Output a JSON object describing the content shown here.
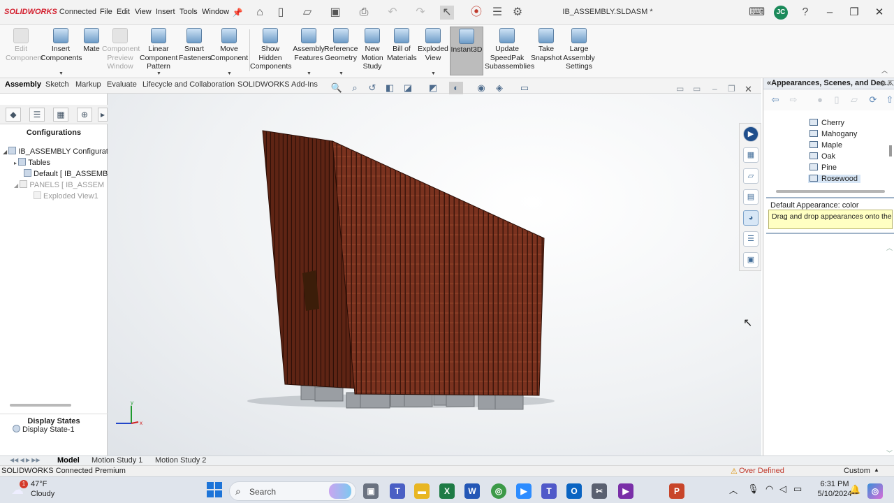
{
  "app": {
    "brand": "SOLIDWORKS",
    "edition": "Connected",
    "document_title": "IB_ASSEMBLY.SLDASM *",
    "user_initials": "JC"
  },
  "menu": [
    "File",
    "Edit",
    "View",
    "Insert",
    "Tools",
    "Window"
  ],
  "ribbon": [
    {
      "label": "Edit Component",
      "enabled": false
    },
    {
      "label": "Insert Components",
      "enabled": true
    },
    {
      "label": "Mate",
      "enabled": true
    },
    {
      "label": "Component Preview Window",
      "enabled": false
    },
    {
      "label": "Linear Component Pattern",
      "enabled": true
    },
    {
      "label": "Smart Fasteners",
      "enabled": true
    },
    {
      "label": "Move Component",
      "enabled": true
    },
    {
      "label": "Show Hidden Components",
      "enabled": true
    },
    {
      "label": "Assembly Features",
      "enabled": true
    },
    {
      "label": "Reference Geometry",
      "enabled": true
    },
    {
      "label": "New Motion Study",
      "enabled": true
    },
    {
      "label": "Bill of Materials",
      "enabled": true
    },
    {
      "label": "Exploded View",
      "enabled": true
    },
    {
      "label": "Instant3D",
      "enabled": true,
      "active": true
    },
    {
      "label": "Update SpeedPak Subassemblies",
      "enabled": true
    },
    {
      "label": "Take Snapshot",
      "enabled": true
    },
    {
      "label": "Large Assembly Settings",
      "enabled": true
    }
  ],
  "command_tabs": [
    "Assembly",
    "Sketch",
    "Markup",
    "Evaluate",
    "Lifecycle and Collaboration",
    "SOLIDWORKS Add-Ins"
  ],
  "left_panel": {
    "title": "Configurations",
    "tree": [
      {
        "label": "IB_ASSEMBLY Configuration",
        "level": 0,
        "gray": false
      },
      {
        "label": "Tables",
        "level": 1,
        "gray": false
      },
      {
        "label": "Default [ IB_ASSEMB",
        "level": 2,
        "gray": false
      },
      {
        "label": "PANELS [ IB_ASSEM",
        "level": 1,
        "gray": true
      },
      {
        "label": "Exploded View1",
        "level": 2,
        "gray": true
      }
    ],
    "display_states_title": "Display States",
    "display_state": "Display State-1"
  },
  "task_pane": {
    "title": "Appearances, Scenes, and Dec...",
    "folders": [
      "Cherry",
      "Mahogany",
      "Maple",
      "Oak",
      "Pine",
      "Rosewood"
    ],
    "selected_folder": "Rosewood",
    "default_label": "Default Appearance: color",
    "hint": "Drag and drop appearances onto the ..."
  },
  "model_tabs": [
    "Model",
    "Motion Study 1",
    "Motion Study 2"
  ],
  "status": {
    "left": "SOLIDWORKS Connected Premium",
    "warning": "Over Defined",
    "units": "Custom"
  },
  "taskbar": {
    "weather_temp": "47°F",
    "weather_desc": "Cloudy",
    "weather_badge": "1",
    "search": "Search",
    "time": "6:31 PM",
    "date": "5/10/2024"
  },
  "colors": {
    "accent": "#d3202f",
    "wood": "#6b2d1c",
    "wood_light": "#8a4129",
    "selection": "#d7e6f6",
    "hint_bg": "#ffffc2"
  }
}
